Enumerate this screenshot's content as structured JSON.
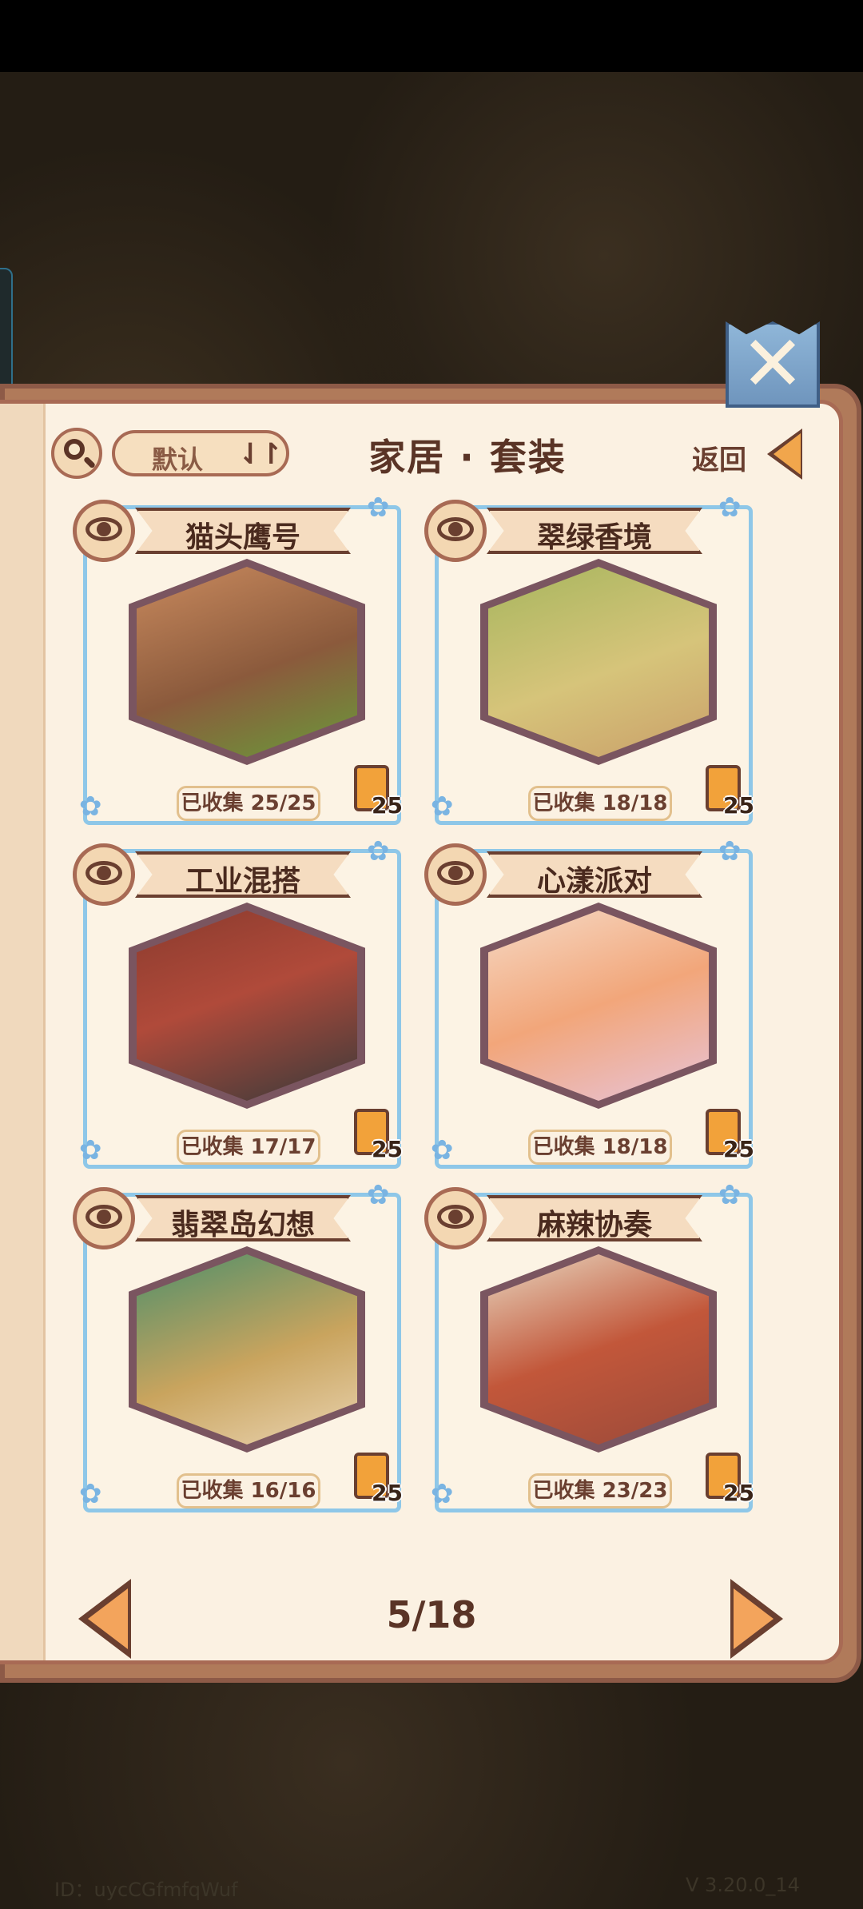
{
  "header": {
    "sort_label": "默认",
    "sort_icon": "⇃↾",
    "title": "家居 · 套装",
    "back_label": "返回"
  },
  "close_glyph": "✕",
  "cards": [
    {
      "name": "猫头鹰号",
      "progress": "已收集 25/25",
      "book_count": "25",
      "colors": [
        "#6a9a3a",
        "#c98a5e",
        "#8b5a3c"
      ]
    },
    {
      "name": "翠绿香境",
      "progress": "已收集 18/18",
      "book_count": "25",
      "colors": [
        "#d6c47a",
        "#a7b65e",
        "#caa06a"
      ]
    },
    {
      "name": "工业混搭",
      "progress": "已收集 17/17",
      "book_count": "25",
      "colors": [
        "#8a3b2e",
        "#3a3a3a",
        "#b04a3a"
      ]
    },
    {
      "name": "心漾派对",
      "progress": "已收集 18/18",
      "book_count": "25",
      "colors": [
        "#f5d9c4",
        "#f2a67a",
        "#e7c3d8"
      ]
    },
    {
      "name": "翡翠岛幻想",
      "progress": "已收集 16/16",
      "book_count": "25",
      "colors": [
        "#4f8f6a",
        "#c9a45e",
        "#e9d3b0"
      ]
    },
    {
      "name": "麻辣协奏",
      "progress": "已收集 23/23",
      "book_count": "25",
      "colors": [
        "#c2573a",
        "#e8d7c0",
        "#9a4a3a"
      ]
    }
  ],
  "pager": {
    "current": "5/18"
  },
  "footer": {
    "id_text": "ID：uycCGfmfqWuf",
    "version": "V 3.20.0_14"
  }
}
